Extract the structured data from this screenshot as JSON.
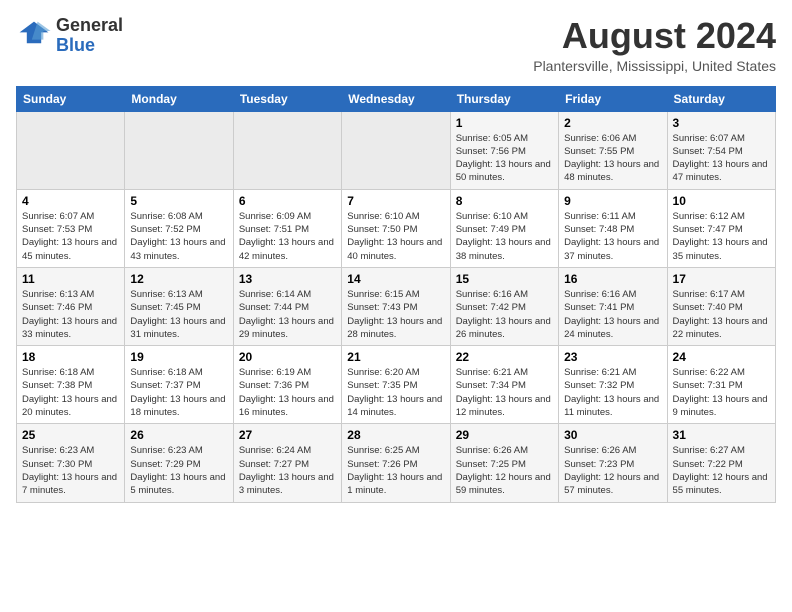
{
  "header": {
    "logo_general": "General",
    "logo_blue": "Blue",
    "month_year": "August 2024",
    "location": "Plantersville, Mississippi, United States"
  },
  "calendar": {
    "days_of_week": [
      "Sunday",
      "Monday",
      "Tuesday",
      "Wednesday",
      "Thursday",
      "Friday",
      "Saturday"
    ],
    "weeks": [
      {
        "row": 1,
        "cells": [
          {
            "day": "",
            "empty": true
          },
          {
            "day": "",
            "empty": true
          },
          {
            "day": "",
            "empty": true
          },
          {
            "day": "",
            "empty": true
          },
          {
            "day": "1",
            "sunrise": "6:05 AM",
            "sunset": "7:56 PM",
            "daylight": "13 hours and 50 minutes."
          },
          {
            "day": "2",
            "sunrise": "6:06 AM",
            "sunset": "7:55 PM",
            "daylight": "13 hours and 48 minutes."
          },
          {
            "day": "3",
            "sunrise": "6:07 AM",
            "sunset": "7:54 PM",
            "daylight": "13 hours and 47 minutes."
          }
        ]
      },
      {
        "row": 2,
        "cells": [
          {
            "day": "4",
            "sunrise": "6:07 AM",
            "sunset": "7:53 PM",
            "daylight": "13 hours and 45 minutes."
          },
          {
            "day": "5",
            "sunrise": "6:08 AM",
            "sunset": "7:52 PM",
            "daylight": "13 hours and 43 minutes."
          },
          {
            "day": "6",
            "sunrise": "6:09 AM",
            "sunset": "7:51 PM",
            "daylight": "13 hours and 42 minutes."
          },
          {
            "day": "7",
            "sunrise": "6:10 AM",
            "sunset": "7:50 PM",
            "daylight": "13 hours and 40 minutes."
          },
          {
            "day": "8",
            "sunrise": "6:10 AM",
            "sunset": "7:49 PM",
            "daylight": "13 hours and 38 minutes."
          },
          {
            "day": "9",
            "sunrise": "6:11 AM",
            "sunset": "7:48 PM",
            "daylight": "13 hours and 37 minutes."
          },
          {
            "day": "10",
            "sunrise": "6:12 AM",
            "sunset": "7:47 PM",
            "daylight": "13 hours and 35 minutes."
          }
        ]
      },
      {
        "row": 3,
        "cells": [
          {
            "day": "11",
            "sunrise": "6:13 AM",
            "sunset": "7:46 PM",
            "daylight": "13 hours and 33 minutes."
          },
          {
            "day": "12",
            "sunrise": "6:13 AM",
            "sunset": "7:45 PM",
            "daylight": "13 hours and 31 minutes."
          },
          {
            "day": "13",
            "sunrise": "6:14 AM",
            "sunset": "7:44 PM",
            "daylight": "13 hours and 29 minutes."
          },
          {
            "day": "14",
            "sunrise": "6:15 AM",
            "sunset": "7:43 PM",
            "daylight": "13 hours and 28 minutes."
          },
          {
            "day": "15",
            "sunrise": "6:16 AM",
            "sunset": "7:42 PM",
            "daylight": "13 hours and 26 minutes."
          },
          {
            "day": "16",
            "sunrise": "6:16 AM",
            "sunset": "7:41 PM",
            "daylight": "13 hours and 24 minutes."
          },
          {
            "day": "17",
            "sunrise": "6:17 AM",
            "sunset": "7:40 PM",
            "daylight": "13 hours and 22 minutes."
          }
        ]
      },
      {
        "row": 4,
        "cells": [
          {
            "day": "18",
            "sunrise": "6:18 AM",
            "sunset": "7:38 PM",
            "daylight": "13 hours and 20 minutes."
          },
          {
            "day": "19",
            "sunrise": "6:18 AM",
            "sunset": "7:37 PM",
            "daylight": "13 hours and 18 minutes."
          },
          {
            "day": "20",
            "sunrise": "6:19 AM",
            "sunset": "7:36 PM",
            "daylight": "13 hours and 16 minutes."
          },
          {
            "day": "21",
            "sunrise": "6:20 AM",
            "sunset": "7:35 PM",
            "daylight": "13 hours and 14 minutes."
          },
          {
            "day": "22",
            "sunrise": "6:21 AM",
            "sunset": "7:34 PM",
            "daylight": "13 hours and 12 minutes."
          },
          {
            "day": "23",
            "sunrise": "6:21 AM",
            "sunset": "7:32 PM",
            "daylight": "13 hours and 11 minutes."
          },
          {
            "day": "24",
            "sunrise": "6:22 AM",
            "sunset": "7:31 PM",
            "daylight": "13 hours and 9 minutes."
          }
        ]
      },
      {
        "row": 5,
        "cells": [
          {
            "day": "25",
            "sunrise": "6:23 AM",
            "sunset": "7:30 PM",
            "daylight": "13 hours and 7 minutes."
          },
          {
            "day": "26",
            "sunrise": "6:23 AM",
            "sunset": "7:29 PM",
            "daylight": "13 hours and 5 minutes."
          },
          {
            "day": "27",
            "sunrise": "6:24 AM",
            "sunset": "7:27 PM",
            "daylight": "13 hours and 3 minutes."
          },
          {
            "day": "28",
            "sunrise": "6:25 AM",
            "sunset": "7:26 PM",
            "daylight": "13 hours and 1 minute."
          },
          {
            "day": "29",
            "sunrise": "6:26 AM",
            "sunset": "7:25 PM",
            "daylight": "12 hours and 59 minutes."
          },
          {
            "day": "30",
            "sunrise": "6:26 AM",
            "sunset": "7:23 PM",
            "daylight": "12 hours and 57 minutes."
          },
          {
            "day": "31",
            "sunrise": "6:27 AM",
            "sunset": "7:22 PM",
            "daylight": "12 hours and 55 minutes."
          }
        ]
      }
    ]
  }
}
